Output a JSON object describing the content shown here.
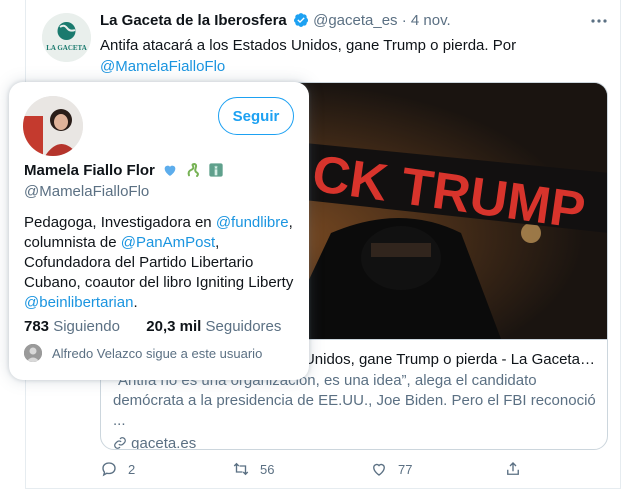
{
  "tweet": {
    "author_name": "La Gaceta de la Iberosfera",
    "author_handle": "@gaceta_es",
    "separator": "·",
    "date": "4 nov.",
    "more_icon": "more-dots-icon",
    "text_main": "Antifa atacará a los Estados Unidos, gane Trump o pierda. Por",
    "text_mention": "@MamelaFialloFlo",
    "avatar_label": "LA GACETA"
  },
  "card": {
    "image_text": "CK TRUMP",
    "title": "Antifa atacará a los Estados Unidos, gane Trump o pierda - La Gaceta de la Iberosfera",
    "description": "“Antifa no es una organización, es una idea”, alega el candidato demócrata a la presidencia de EE.UU., Joe Biden. Pero el FBI reconoció ...",
    "domain": "gaceta.es",
    "domain_icon": "link-icon"
  },
  "actions": {
    "reply_count": "2",
    "retweet_count": "56",
    "like_count": "77"
  },
  "hovercard": {
    "follow_label": "Seguir",
    "name": "Mamela Fiallo Flor",
    "name_emojis": [
      "blue-heart-icon",
      "snake-icon",
      "statue-of-liberty-icon"
    ],
    "handle": "@MamelaFialloFlo",
    "bio": [
      {
        "t": "Pedagoga, Investigadora en "
      },
      {
        "t": "@fundlibre",
        "link": true
      },
      {
        "t": ", columnista de "
      },
      {
        "t": "@PanAmPost",
        "link": true
      },
      {
        "t": ", Cofundadora del Partido Libertario Cubano, coautor del libro Igniting Liberty "
      },
      {
        "t": "@beinlibertarian",
        "link": true
      },
      {
        "t": "."
      }
    ],
    "following_count": "783",
    "following_label": "Siguiendo",
    "followers_count": "20,3 mil",
    "followers_label": "Seguidores",
    "social_context": "Alfredo Velazco sigue a este usuario"
  },
  "colors": {
    "accent": "#1da1f2",
    "link": "#1b95e0",
    "secondary_text": "#5b7083",
    "border": "#ccd6dd"
  }
}
